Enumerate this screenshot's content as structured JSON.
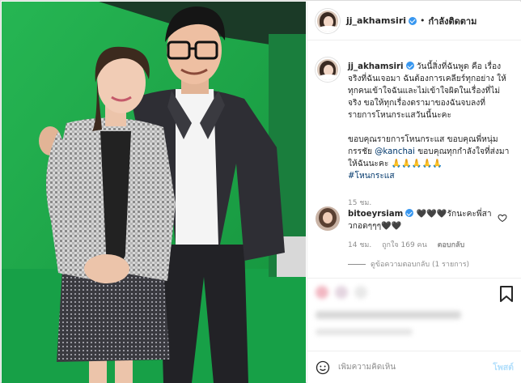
{
  "post": {
    "username": "jj_akhamsiri",
    "header_dot": "•",
    "follow_status": "กำลังติดตาม",
    "caption_username": "jj_akhamsiri",
    "caption_line1": "วันนี้สิ่งที่ฉันพูด คือ เรื่อง จริงที่ฉันเจอมา ฉันต้องการเคลียร์ทุกอย่าง ให้ทุกคนเข้าใจฉันและไม่เข้าใจผิดในเรื่องที่ไม่จริง ขอให้ทุกเรื่องดรามาของฉันจบลงที่รายการโหนกระแสวันนี้นะคะ",
    "caption_line2_before": "ขอบคุณรายการโหนกระแส ขอบคุณพี่หนุ่มกรรชัย ",
    "caption_mention": "@kanchai",
    "caption_line2_after": " ขอบคุณทุกกำลังใจที่ส่งมาให้ฉันนะคะ 🙏🙏🙏🙏🙏",
    "hashtag": "#โหนกระแส",
    "time": "15 ชม."
  },
  "comment": {
    "username": "bitoeyrsiam",
    "text": " 🖤🖤🖤รักนะคะพี่สาวกอดๆๆๆ🖤🖤",
    "time": "14 ชม.",
    "likes": "ถูกใจ 169 คน",
    "reply": "ตอบกลับ",
    "view_replies": "ดูข้อความตอบกลับ (1 รายการ)"
  },
  "add_comment": {
    "placeholder": "เพิ่มความคิดเห็น",
    "post_label": "โพสต์"
  },
  "icons": {
    "comment_like": "heart-outline-icon",
    "bookmark": "bookmark-icon",
    "emoji": "emoji-face-icon"
  },
  "colors": {
    "verified": "#3897f0",
    "link": "#00376b",
    "post_disabled": "#b2dffc",
    "green_screen": "#1fa54a"
  }
}
